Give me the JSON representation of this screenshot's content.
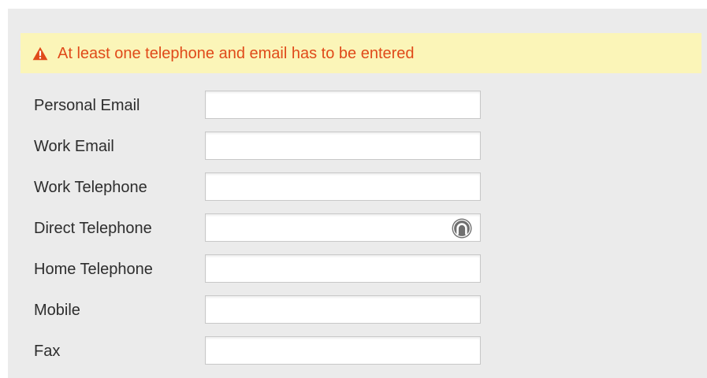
{
  "alert": {
    "message": "At least one telephone and email has to be entered",
    "icon": "warning-triangle-icon",
    "text_color": "#e04a1a",
    "background": "#fbf5b8"
  },
  "form": {
    "fields": [
      {
        "label": "Personal Email",
        "value": "",
        "placeholder": ""
      },
      {
        "label": "Work Email",
        "value": "",
        "placeholder": ""
      },
      {
        "label": "Work Telephone",
        "value": "",
        "placeholder": ""
      },
      {
        "label": "Direct Telephone",
        "value": "",
        "placeholder": "",
        "icon": "autofill-icon"
      },
      {
        "label": "Home Telephone",
        "value": "",
        "placeholder": ""
      },
      {
        "label": "Mobile",
        "value": "",
        "placeholder": ""
      },
      {
        "label": "Fax",
        "value": "",
        "placeholder": ""
      }
    ]
  }
}
